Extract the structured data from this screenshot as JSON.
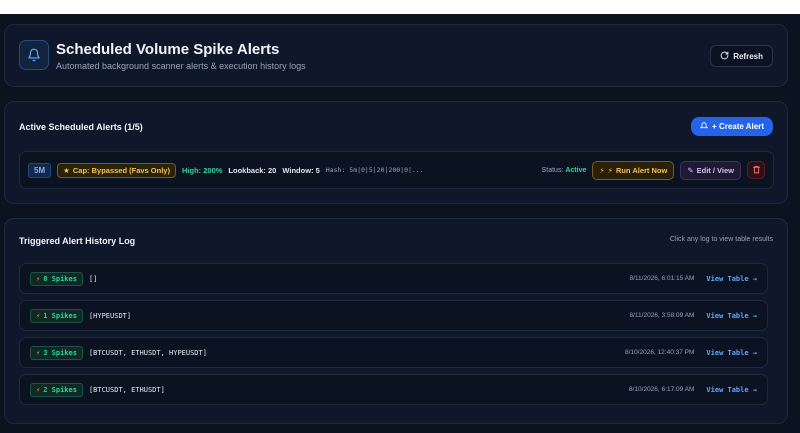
{
  "header": {
    "title": "Scheduled Volume Spike Alerts",
    "subtitle": "Automated background scanner alerts & execution history logs",
    "refresh_label": "Refresh",
    "icon": "bell-icon"
  },
  "active": {
    "title": "Active Scheduled Alerts (1/5)",
    "create_label": "+ Create Alert",
    "alert": {
      "timeframe": "5M",
      "cap": "Cap: Bypassed (Favs Only)",
      "high": "High: 200%",
      "lookback": "Lookback: 20",
      "window": "Window: 5",
      "hash": "Hash: 5m|0|5|20|200|0|...",
      "status_label": "Status:",
      "status_value": "Active",
      "run_label": "Run Alert Now",
      "edit_label": "Edit / View"
    }
  },
  "history": {
    "title": "Triggered Alert History Log",
    "hint": "Click any log to view table results",
    "rows": [
      {
        "spikes": "0 Spikes",
        "symbols": "[]",
        "time": "8/11/2026, 6:01:15 AM",
        "view": "View Table →"
      },
      {
        "spikes": "1 Spikes",
        "symbols": "[HYPEUSDT]",
        "time": "8/11/2026, 3:58:09 AM",
        "view": "View Table →"
      },
      {
        "spikes": "3 Spikes",
        "symbols": "[BTCUSDT, ETHUSDT, HYPEUSDT]",
        "time": "8/10/2026, 12:40:37 PM",
        "view": "View Table →"
      },
      {
        "spikes": "2 Spikes",
        "symbols": "[BTCUSDT, ETHUSDT]",
        "time": "8/10/2026, 6:17:09 AM",
        "view": "View Table →"
      }
    ]
  },
  "colors": {
    "background": "#0b1220",
    "panel": "#0f172a",
    "accent": "#2563eb",
    "success": "#34d399",
    "warning": "#f5c451",
    "link": "#60a5fa"
  }
}
